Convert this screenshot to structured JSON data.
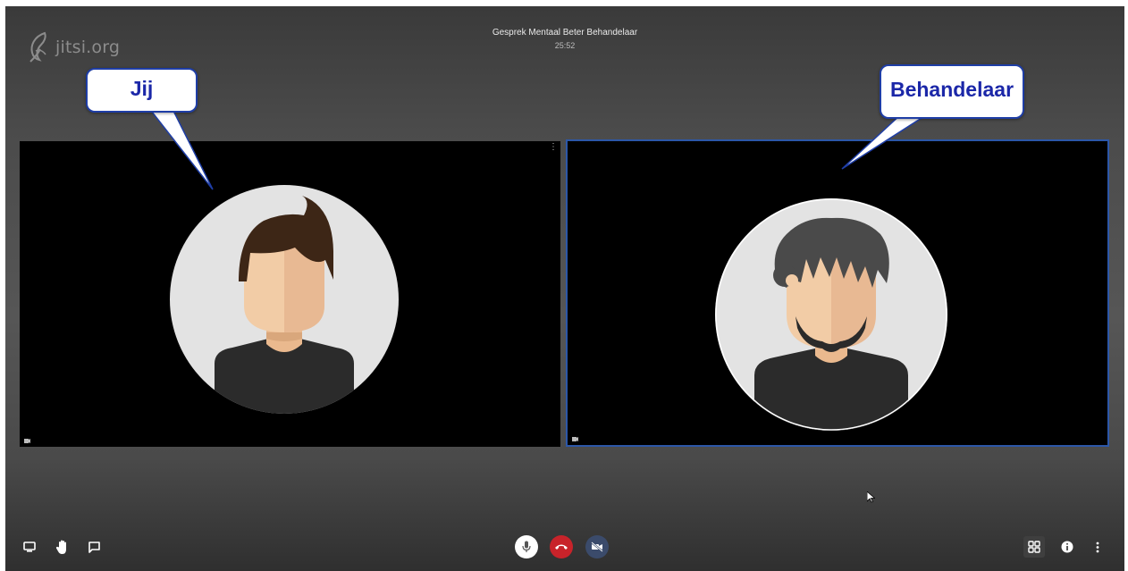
{
  "app": {
    "logo_text": "jitsi.org"
  },
  "meeting": {
    "title": "Gesprek Mentaal Beter Behandelaar",
    "timer": "25:52"
  },
  "participants": [
    {
      "label": "Jij",
      "role": "local"
    },
    {
      "label": "Behandelaar",
      "role": "remote"
    }
  ],
  "colors": {
    "hangup": "#c8232a",
    "remote_border": "#2c57a8",
    "bubble_text": "#1b27a8"
  },
  "toolbar": {
    "left": [
      "screen-share-icon",
      "raise-hand-icon",
      "chat-icon"
    ],
    "center": [
      "microphone-icon",
      "hangup-icon",
      "camera-off-icon"
    ],
    "right": [
      "tile-view-icon",
      "info-icon",
      "more-options-icon"
    ]
  }
}
